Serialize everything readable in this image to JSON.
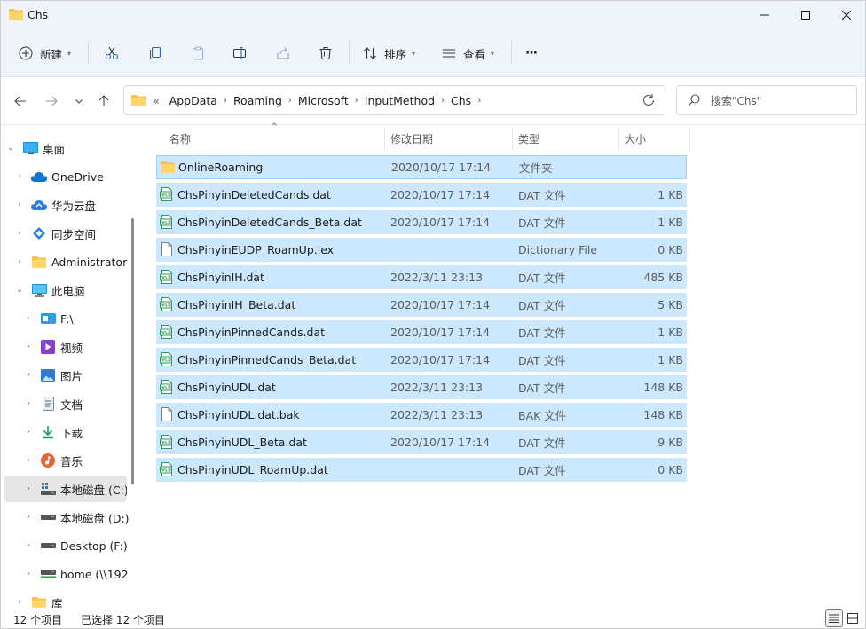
{
  "window": {
    "title": "Chs"
  },
  "toolbar": {
    "new_label": "新建",
    "sort_label": "排序",
    "view_label": "查看",
    "more_label": "···"
  },
  "address": {
    "overflow": "«",
    "crumbs": [
      "AppData",
      "Roaming",
      "Microsoft",
      "InputMethod",
      "Chs"
    ]
  },
  "search": {
    "placeholder": "搜索\"Chs\""
  },
  "sidebar": {
    "items": [
      {
        "label": "桌面",
        "expanded": true
      },
      {
        "label": "OneDrive"
      },
      {
        "label": "华为云盘"
      },
      {
        "label": "同步空间"
      },
      {
        "label": "Administrator"
      },
      {
        "label": "此电脑",
        "expanded": true
      },
      {
        "label": "F:\\"
      },
      {
        "label": "视频"
      },
      {
        "label": "图片"
      },
      {
        "label": "文档"
      },
      {
        "label": "下载"
      },
      {
        "label": "音乐"
      },
      {
        "label": "本地磁盘 (C:)",
        "selected": true
      },
      {
        "label": "本地磁盘 (D:)"
      },
      {
        "label": "Desktop (F:)"
      },
      {
        "label": "home (\\\\192"
      },
      {
        "label": "库"
      }
    ]
  },
  "columns": {
    "name": "名称",
    "date": "修改日期",
    "type": "类型",
    "size": "大小"
  },
  "files": [
    {
      "name": "OnlineRoaming",
      "date": "2020/10/17 17:14",
      "type": "文件夹",
      "size": "",
      "icon": "folder-icon"
    },
    {
      "name": "ChsPinyinDeletedCands.dat",
      "date": "2020/10/17 17:14",
      "type": "DAT 文件",
      "size": "1 KB",
      "icon": "dat-file-icon"
    },
    {
      "name": "ChsPinyinDeletedCands_Beta.dat",
      "date": "2020/10/17 17:14",
      "type": "DAT 文件",
      "size": "1 KB",
      "icon": "dat-file-icon"
    },
    {
      "name": "ChsPinyinEUDP_RoamUp.lex",
      "date": "",
      "type": "Dictionary File",
      "size": "0 KB",
      "icon": "file-icon"
    },
    {
      "name": "ChsPinyinIH.dat",
      "date": "2022/3/11 23:13",
      "type": "DAT 文件",
      "size": "485 KB",
      "icon": "dat-file-icon"
    },
    {
      "name": "ChsPinyinIH_Beta.dat",
      "date": "2020/10/17 17:14",
      "type": "DAT 文件",
      "size": "5 KB",
      "icon": "dat-file-icon"
    },
    {
      "name": "ChsPinyinPinnedCands.dat",
      "date": "2020/10/17 17:14",
      "type": "DAT 文件",
      "size": "1 KB",
      "icon": "dat-file-icon"
    },
    {
      "name": "ChsPinyinPinnedCands_Beta.dat",
      "date": "2020/10/17 17:14",
      "type": "DAT 文件",
      "size": "1 KB",
      "icon": "dat-file-icon"
    },
    {
      "name": "ChsPinyinUDL.dat",
      "date": "2022/3/11 23:13",
      "type": "DAT 文件",
      "size": "148 KB",
      "icon": "dat-file-icon"
    },
    {
      "name": "ChsPinyinUDL.dat.bak",
      "date": "2022/3/11 23:13",
      "type": "BAK 文件",
      "size": "148 KB",
      "icon": "file-icon"
    },
    {
      "name": "ChsPinyinUDL_Beta.dat",
      "date": "2020/10/17 17:14",
      "type": "DAT 文件",
      "size": "9 KB",
      "icon": "dat-file-icon"
    },
    {
      "name": "ChsPinyinUDL_RoamUp.dat",
      "date": "",
      "type": "DAT 文件",
      "size": "0 KB",
      "icon": "dat-file-icon"
    }
  ],
  "status": {
    "count": "12 个项目",
    "selected": "已选择 12 个项目"
  },
  "colors": {
    "selection": "#cce8ff",
    "selection_border": "#99d1ff",
    "chrome": "#eef4f9",
    "folder": "#f4c24d",
    "dat_icon": "#2e9d5a"
  }
}
